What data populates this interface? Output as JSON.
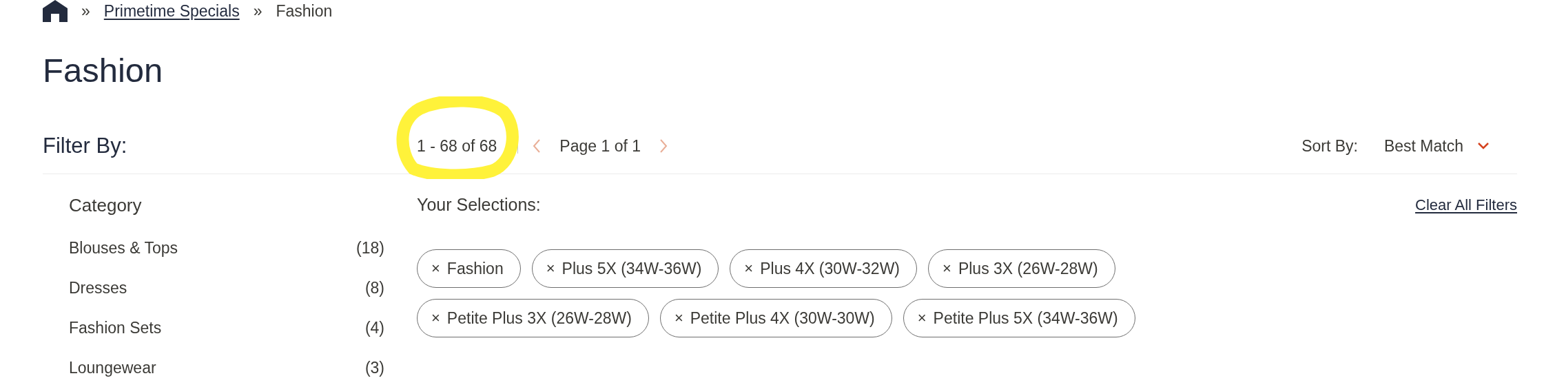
{
  "breadcrumb": [
    {
      "label": "»",
      "kind": "separator"
    },
    {
      "label": "Primetime Specials",
      "kind": "link"
    },
    {
      "label": "»",
      "kind": "separator"
    },
    {
      "label": "Fashion",
      "kind": "current"
    }
  ],
  "title": "Fashion",
  "filter_heading": "Filter By:",
  "category": {
    "heading": "Category",
    "items": [
      {
        "label": "Blouses & Tops",
        "count": "(18)"
      },
      {
        "label": "Dresses",
        "count": "(8)"
      },
      {
        "label": "Fashion Sets",
        "count": "(4)"
      },
      {
        "label": "Loungewear",
        "count": "(3)"
      }
    ]
  },
  "results": {
    "range": "1 - 68 of 68",
    "page": "Page 1 of 1",
    "prev_disabled": true,
    "next_disabled": true
  },
  "sort": {
    "label": "Sort By:",
    "value": "Best Match"
  },
  "selections": {
    "heading": "Your Selections:",
    "clear": "Clear All Filters",
    "chips": [
      {
        "close": "×",
        "label": "Fashion"
      },
      {
        "close": "×",
        "label": "Plus 5X (34W-36W)"
      },
      {
        "close": "×",
        "label": "Plus 4X (30W-32W)"
      },
      {
        "close": "×",
        "label": "Plus 3X (26W-28W)"
      },
      {
        "close": "×",
        "label": "Petite Plus 3X (26W-28W)"
      },
      {
        "close": "×",
        "label": "Petite Plus 4X (30W-30W)"
      },
      {
        "close": "×",
        "label": "Petite Plus 5X (34W-36W)"
      }
    ]
  }
}
